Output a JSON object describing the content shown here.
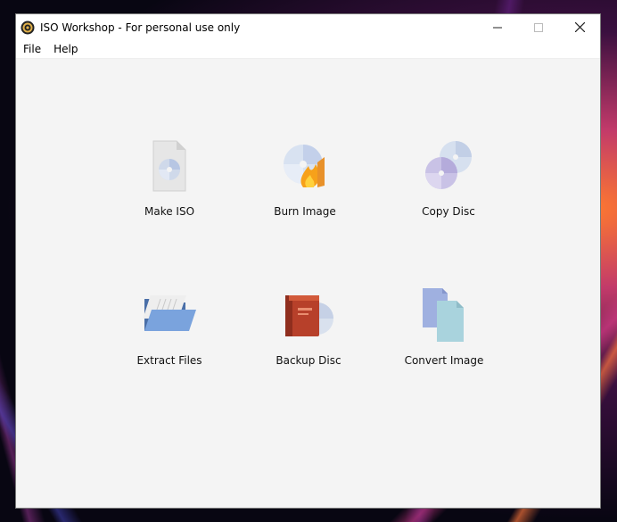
{
  "window": {
    "title": "ISO Workshop - For personal use only",
    "controls": [
      "minimize",
      "maximize",
      "close"
    ]
  },
  "menubar": {
    "items": [
      {
        "label": "File"
      },
      {
        "label": "Help"
      }
    ]
  },
  "actions": [
    {
      "label": "Make ISO",
      "icon": "make-iso-icon"
    },
    {
      "label": "Burn Image",
      "icon": "burn-image-icon"
    },
    {
      "label": "Copy Disc",
      "icon": "copy-disc-icon"
    },
    {
      "label": "Extract Files",
      "icon": "extract-files-icon"
    },
    {
      "label": "Backup Disc",
      "icon": "backup-disc-icon"
    },
    {
      "label": "Convert Image",
      "icon": "convert-image-icon"
    }
  ],
  "colors": {
    "window_bg": "#f4f4f4",
    "titlebar_bg": "#ffffff"
  }
}
